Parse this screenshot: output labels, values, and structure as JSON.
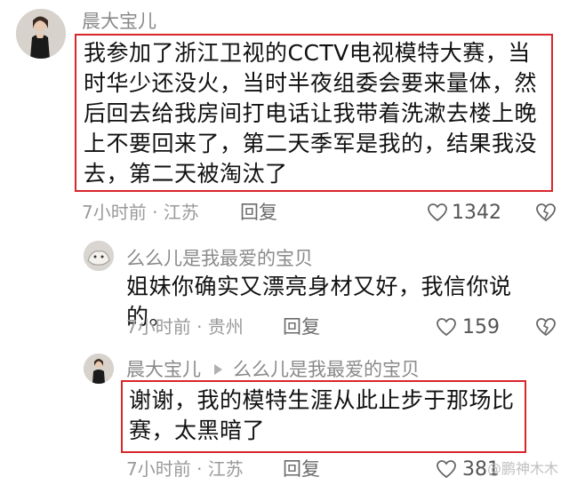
{
  "comments": [
    {
      "author": "晨大宝儿",
      "text": "我参加了浙江卫视的CCTV电视模特大赛，当时华少还没火，当时半夜组委会要来量体，然后回去给我房间打电话让我带着洗漱去楼上晚上不要回来了，第二天季军是我的，结果我没去，第二天被淘汰了",
      "time_location": "7小时前 · 江苏",
      "reply_label": "回复",
      "likes": "1342"
    },
    {
      "author": "么么儿是我最爱的宝贝",
      "text": "姐妹你确实又漂亮身材又好，我信你说的。",
      "time_location": "7小时前 · 贵州",
      "reply_label": "回复",
      "likes": "159"
    },
    {
      "author": "晨大宝儿",
      "reply_to": "么么儿是我最爱的宝贝",
      "text": "谢谢，我的模特生涯从此止步于那场比赛，太黑暗了",
      "time_location": "7小时前 · 江苏",
      "reply_label": "回复",
      "likes": "381"
    }
  ],
  "watermark": "@鹏神木木",
  "colors": {
    "highlight_border": "#d8262a",
    "meta_text": "#9a9a9a",
    "background": "#ffffff"
  },
  "icons": [
    "avatar",
    "heart-icon",
    "dislike-icon",
    "reply-arrow-icon"
  ]
}
